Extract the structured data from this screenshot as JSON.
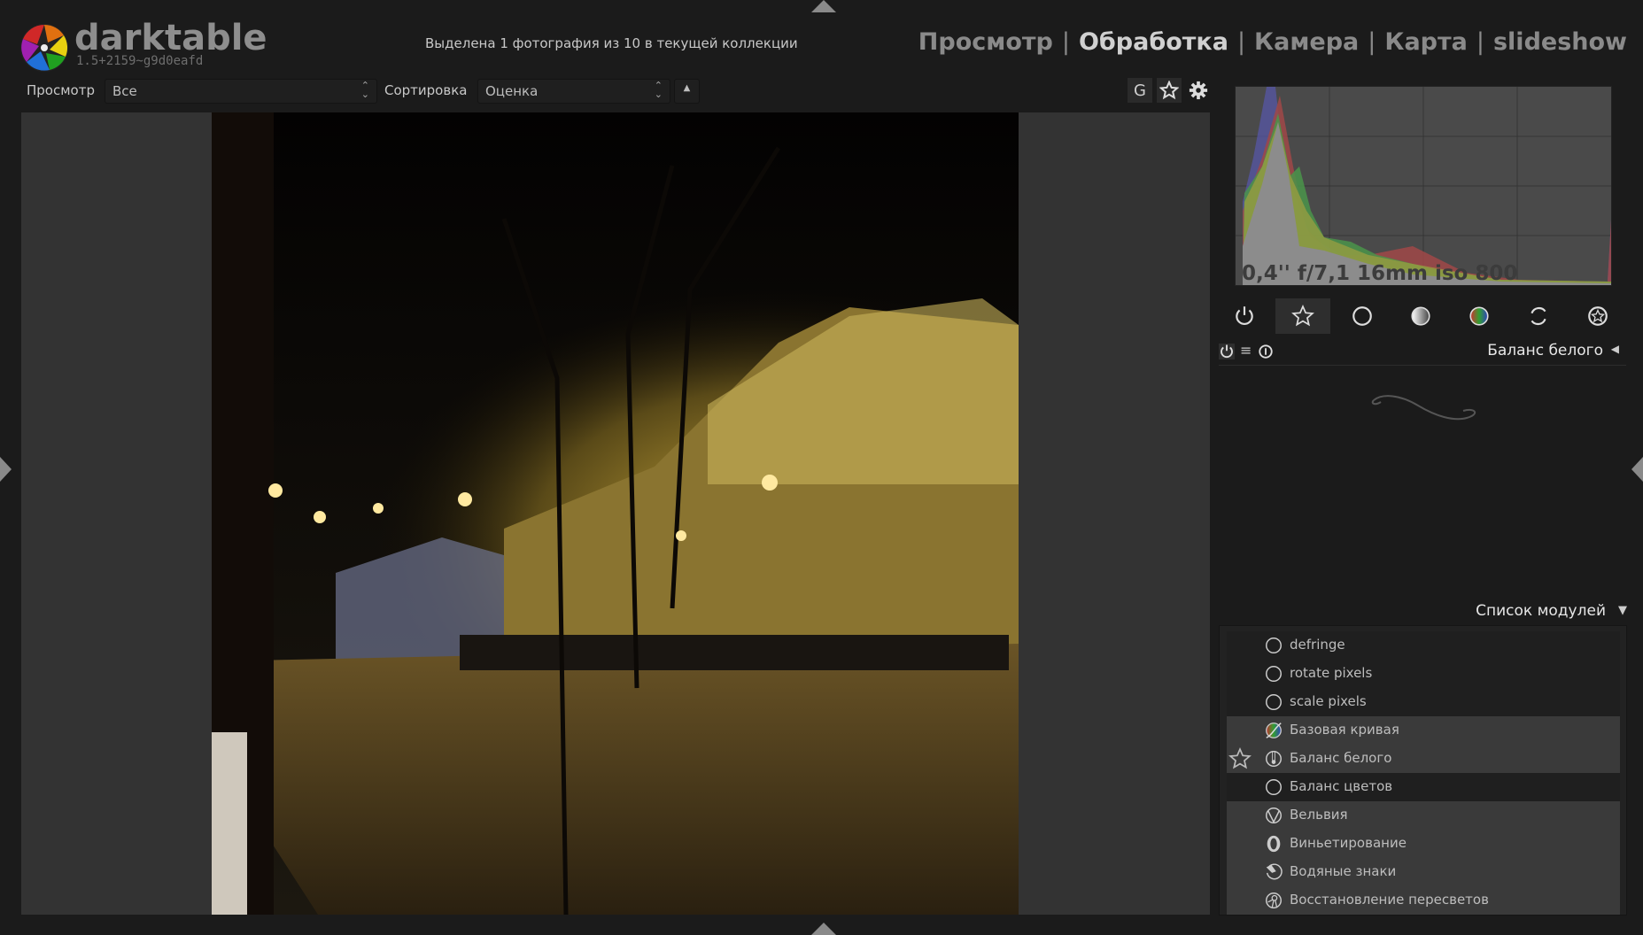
{
  "app": {
    "name": "darktable",
    "version": "1.5+2159~g9d0eafd"
  },
  "header": {
    "selection_info": "Выделена 1 фотография из 10 в текущей коллекции",
    "views": [
      {
        "label": "Просмотр",
        "active": false
      },
      {
        "label": "Обработка",
        "active": true
      },
      {
        "label": "Камера",
        "active": false
      },
      {
        "label": "Карта",
        "active": false
      },
      {
        "label": "slideshow",
        "active": false
      }
    ],
    "separator": "|"
  },
  "filterbar": {
    "view_label": "Просмотр",
    "view_value": "Все",
    "sort_label": "Сортировка",
    "sort_value": "Оценка",
    "sort_order_icon": "triangle-up-icon",
    "right_buttons": [
      {
        "label": "G",
        "name": "grouping"
      },
      {
        "icon": "star-icon",
        "name": "overlays"
      },
      {
        "icon": "gear-icon",
        "name": "preferences"
      }
    ]
  },
  "histogram": {
    "exif": "0,4'' f/7,1 16mm iso 800",
    "colors": {
      "red": "#b04848",
      "green": "#4a9a4a",
      "blue": "#5050a0"
    }
  },
  "module_groups": [
    {
      "icon": "power-icon",
      "active": false
    },
    {
      "icon": "star-icon",
      "active": true
    },
    {
      "icon": "circle-icon",
      "active": false
    },
    {
      "icon": "gradient-sphere-icon",
      "active": false
    },
    {
      "icon": "color-sphere-icon",
      "active": false
    },
    {
      "icon": "rotate-icon",
      "active": false
    },
    {
      "icon": "effects-icon",
      "active": false
    }
  ],
  "module": {
    "title": "Баланс белого",
    "expanded": false
  },
  "module_list": {
    "title": "Список модулей",
    "items": [
      {
        "label": "defringe",
        "icon": "circle-icon",
        "style": "dark",
        "favorite": false
      },
      {
        "label": "rotate pixels",
        "icon": "circle-icon",
        "style": "dark",
        "favorite": false
      },
      {
        "label": "scale pixels",
        "icon": "circle-icon",
        "style": "dark",
        "favorite": false
      },
      {
        "label": "Базовая кривая",
        "icon": "base-curve-icon",
        "style": "gray",
        "favorite": false
      },
      {
        "label": "Баланс белого",
        "icon": "thermometer-icon",
        "style": "gray",
        "favorite": true
      },
      {
        "label": "Баланс цветов",
        "icon": "circle-icon",
        "style": "dark",
        "favorite": false
      },
      {
        "label": "Вельвия",
        "icon": "velvia-icon",
        "style": "gray",
        "favorite": false
      },
      {
        "label": "Виньетирование",
        "icon": "vignette-icon",
        "style": "gray",
        "favorite": false
      },
      {
        "label": "Водяные знаки",
        "icon": "watermark-icon",
        "style": "gray",
        "favorite": false
      },
      {
        "label": "Восстановление пересветов",
        "icon": "highlights-icon",
        "style": "gray",
        "favorite": false
      }
    ]
  }
}
